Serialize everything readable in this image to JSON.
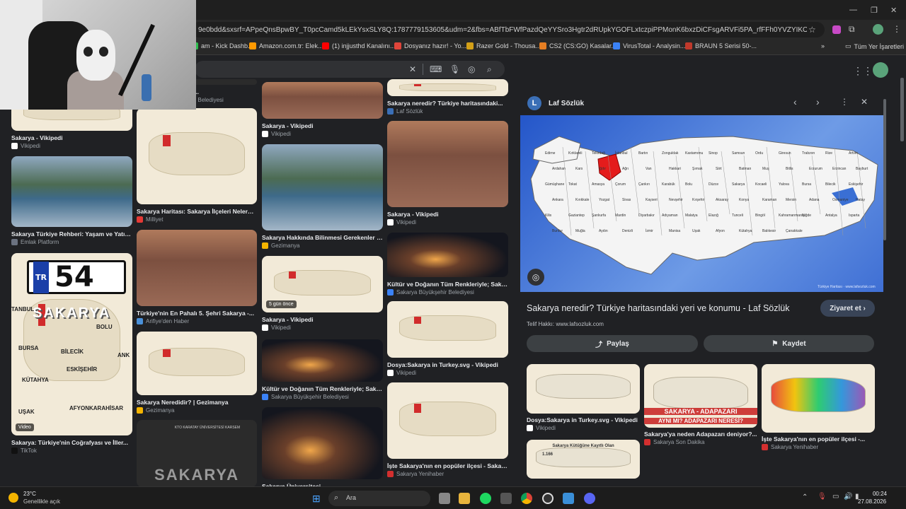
{
  "browser": {
    "url": "9e0bdd&sxsrf=APpeQnsBpwBY_T0pcCamd5kLEkYsxSLY8Q:1787779153605&udm=2&fbs=ABfTbFWfPazdQeYYSro3Hgtr2dRUpkYGOFLxtczpiPPMonK6bxzDiCFsgARVFi5PA_rfFFh0YVZYIKOkKt9HP363KwEJEHwR...",
    "bookmarks": [
      {
        "label": "am - Kick Dashb...",
        "color": "#2dbe4e"
      },
      {
        "label": "Amazon.com.tr: Elek...",
        "color": "#ff9900"
      },
      {
        "label": "(1) injjusthd Kanalını...",
        "color": "#ff0000"
      },
      {
        "label": "Dosyanız hazır! - Yo...",
        "color": "#e0453a"
      },
      {
        "label": "Razer Gold - Thousa...",
        "color": "#d4a017"
      },
      {
        "label": "CS2 (CS:GO) Kasalar...",
        "color": "#e67e22"
      },
      {
        "label": "VirusTotal - Analysin...",
        "color": "#3b82f6"
      },
      {
        "label": "BRAUN 5 Serisi 50-...",
        "color": "#c0392b"
      }
    ],
    "bookmarks_all": "Tüm Yer İşaretleri"
  },
  "grid": {
    "col1": [
      {
        "caption": "Sakarya - Vikipedi",
        "source": "Vikipedi"
      },
      {
        "caption": "Sakarya Türkiye Rehberi: Yaşam ve Yatırım",
        "source": "Emlak Platform"
      },
      {
        "caption": "Sakarya: Türkiye'nin Coğrafyası ve İller...",
        "source": "TikTok",
        "badge": "Video",
        "overlay_plate": "TR 54",
        "overlay_title": "SAKARYA",
        "map_labels": [
          "BOLU",
          "BURSA",
          "BİLECİK",
          "ESKİŞEHİR",
          "KÜTAHYA",
          "UŞAK",
          "AFYONKARAHİSAR",
          "TANBUL",
          "ANK"
        ]
      }
    ],
    "col2": [
      {
        "caption": "Sakarya Büyükşehir...",
        "source": "Sakarya Büyükşehir Belediyesi"
      },
      {
        "caption": "Sakarya Haritası: Sakarya İlçeleri Nelerdir...",
        "source": "Milliyet"
      },
      {
        "caption": "Türkiye'nin En Pahalı 5. Şehri Sakarya -...",
        "source": "Arifiye'den Haber"
      },
      {
        "caption": "Sakarya Neredidir? | Gezimanya",
        "source": "Gezimanya"
      },
      {
        "caption": "",
        "source": "",
        "overlay_title": "SAKARYA",
        "overlay_sub": "KTO KARATAY ÜNİVERSİTESİ KARSEM"
      }
    ],
    "col3": [
      {
        "caption": "Sakarya - Vikipedi",
        "source": "Vikipedi"
      },
      {
        "caption": "Sakarya Hakkında Bilinmesi Gerekenler |...",
        "source": "Gezimanya"
      },
      {
        "caption": "Sakarya - Vikipedi",
        "source": "Vikipedi",
        "badge": "5 gün önce"
      },
      {
        "caption": "Kültür ve Doğanın Tüm Renkleriyle; Sakary...",
        "source": "Sakarya Büyükşehir Belediyesi"
      },
      {
        "caption": "Sakarya Üniversitesi",
        "source": ""
      }
    ],
    "col4": [
      {
        "caption": "Sakarya neredir? Türkiye haritasındaki...",
        "source": "Laf Sözlük"
      },
      {
        "caption": "Sakarya - Vikipedi",
        "source": "Vikipedi"
      },
      {
        "caption": "Kültür ve Doğanın Tüm Renkleriyle; Sakary...",
        "source": "Sakarya Büyükşehir Belediyesi"
      },
      {
        "caption": "Dosya:Sakarya in Turkey.svg - Vikipedi",
        "source": "Vikipedi"
      },
      {
        "caption": "İşte Sakarya'nın en popüler ilçesi - Sakar...",
        "source": "Sakarya Yenihaber"
      }
    ]
  },
  "panel": {
    "site": "Laf Sözlük",
    "title": "Sakarya neredir? Türkiye haritasındaki yeri ve konumu - Laf Sözlük",
    "visit": "Ziyaret et",
    "copyright": "Telif Hakkı: www.lafsozluk.com",
    "share": "Paylaş",
    "save": "Kaydet",
    "map_credit": "Türkiye Haritası · www.lafsozluk.com",
    "cities": [
      "Edirne",
      "Kırklareli",
      "Tekirdağ",
      "İstanbul",
      "Bartın",
      "Zonguldak",
      "Kastamonu",
      "Sinop",
      "Samsun",
      "Ordu",
      "Giresun",
      "Trabzon",
      "Rize",
      "Artvin",
      "Ardahan",
      "Kars",
      "Iğdır",
      "Ağrı",
      "Van",
      "Hakkari",
      "Şırnak",
      "Siirt",
      "Batman",
      "Muş",
      "Bitlis",
      "Erzurum",
      "Erzincan",
      "Bayburt",
      "Gümüşhane",
      "Tokat",
      "Amasya",
      "Çorum",
      "Çankırı",
      "Karabük",
      "Bolu",
      "Düzce",
      "Sakarya",
      "Kocaeli",
      "Yalova",
      "Bursa",
      "Bilecik",
      "Eskişehir",
      "Ankara",
      "Kırıkkale",
      "Yozgat",
      "Sivas",
      "Kayseri",
      "Nevşehir",
      "Kırşehir",
      "Aksaray",
      "Konya",
      "Karaman",
      "Mersin",
      "Adana",
      "Osmaniye",
      "Hatay",
      "Kilis",
      "Gaziantep",
      "Şanlıurfa",
      "Mardin",
      "Diyarbakır",
      "Adıyaman",
      "Malatya",
      "Elazığ",
      "Tunceli",
      "Bingöl",
      "Kahramanmaraş",
      "Niğde",
      "Antalya",
      "Isparta",
      "Burdur",
      "Muğla",
      "Aydın",
      "Denizli",
      "İzmir",
      "Manisa",
      "Uşak",
      "Afyon",
      "Kütahya",
      "Balıkesir",
      "Çanakkale"
    ],
    "thumbs": [
      {
        "caption": "Dosya:Sakarya in Turkey.svg - Vikipedi",
        "source": "Vikipedi"
      },
      {
        "caption": "Sakarya'ya neden Adapazarı deniyor?...",
        "source": "Sakarya Son Dakika",
        "overlay1": "SAKARYA - ADAPAZARI",
        "overlay2": "AYNI MI? ADAPAZARI NERESİ?"
      },
      {
        "caption": "İşte Sakarya'nın en popüler ilçesi -...",
        "source": "Sakarya Yenihaber"
      },
      {
        "caption": "",
        "source": "",
        "overlay1": "Sakarya Kütüğüne Kayıtlı Olan",
        "overlay2": "1.166"
      }
    ]
  },
  "taskbar": {
    "temp": "23°C",
    "weather": "Genellikle açık",
    "search": "Ara",
    "time": "00:24",
    "date": "27.08.2026"
  }
}
